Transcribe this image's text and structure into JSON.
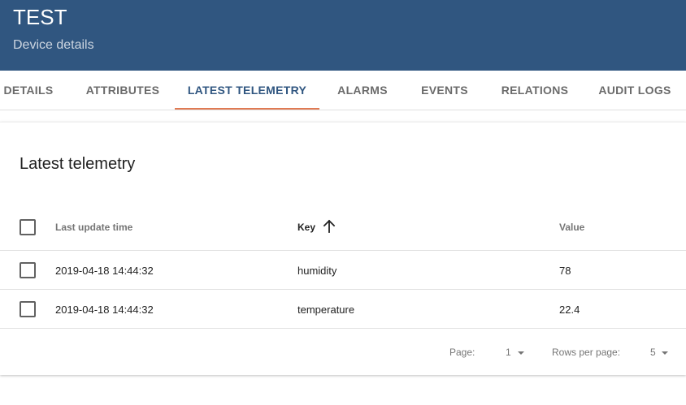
{
  "header": {
    "title": "TEST",
    "subtitle": "Device details"
  },
  "tabs": [
    {
      "label": "DETAILS",
      "active": false
    },
    {
      "label": "ATTRIBUTES",
      "active": false
    },
    {
      "label": "LATEST TELEMETRY",
      "active": true
    },
    {
      "label": "ALARMS",
      "active": false
    },
    {
      "label": "EVENTS",
      "active": false
    },
    {
      "label": "RELATIONS",
      "active": false
    },
    {
      "label": "AUDIT LOGS",
      "active": false
    }
  ],
  "card": {
    "title": "Latest telemetry"
  },
  "table": {
    "columns": {
      "time": "Last update time",
      "key": "Key",
      "value": "Value"
    },
    "sort": {
      "column": "key",
      "direction": "ascending",
      "icon": "arrow-up-icon"
    },
    "rows": [
      {
        "time": "2019-04-18 14:44:32",
        "key": "humidity",
        "value": "78"
      },
      {
        "time": "2019-04-18 14:44:32",
        "key": "temperature",
        "value": "22.4"
      }
    ]
  },
  "pagination": {
    "page_label": "Page:",
    "page_value": "1",
    "rows_label": "Rows per page:",
    "rows_value": "5"
  },
  "colors": {
    "header_bg": "#305680",
    "active_tab": "#305680",
    "tab_ink": "#e07a53"
  }
}
